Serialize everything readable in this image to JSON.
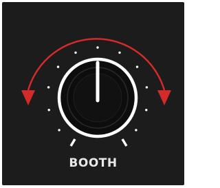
{
  "control": {
    "label": "BOOTH",
    "value": 0.5,
    "scale_dot_count": 11
  },
  "colors": {
    "background": "#1c1c1c",
    "arrow": "#d42a2a",
    "knob_ring": "#ffffff",
    "knob_body": "#0d0d0d",
    "pointer": "#ffffff",
    "scale_dots": "#ffffff",
    "label": "#e8e8e8"
  },
  "icons": {
    "left_arrow": "curved-arrow-left-icon",
    "right_arrow": "curved-arrow-right-icon"
  }
}
